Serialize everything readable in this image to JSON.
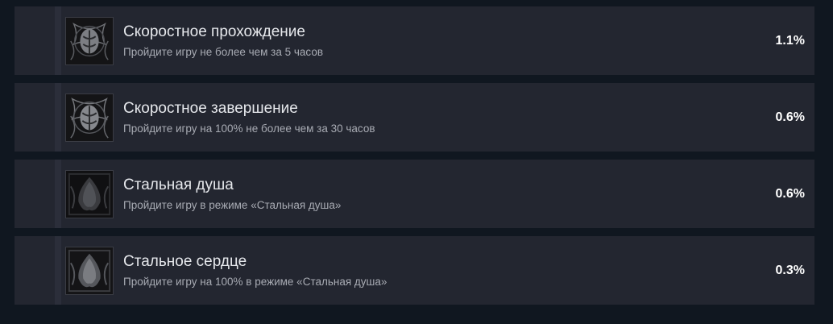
{
  "achievements": [
    {
      "title": "Скоростное прохождение",
      "description": "Пройдите игру не более чем за 5 часов",
      "percent": "1.1%",
      "icon": "speedrun-emblem-icon"
    },
    {
      "title": "Скоростное завершение",
      "description": "Пройдите игру на 100% не более чем за 30 часов",
      "percent": "0.6%",
      "icon": "speed-completion-emblem-icon"
    },
    {
      "title": "Стальная душа",
      "description": "Пройдите игру в режиме «Стальная душа»",
      "percent": "0.6%",
      "icon": "steel-soul-emblem-icon"
    },
    {
      "title": "Стальное сердце",
      "description": "Пройдите игру на 100% в режиме «Стальная душа»",
      "percent": "0.3%",
      "icon": "steel-heart-emblem-icon"
    }
  ]
}
